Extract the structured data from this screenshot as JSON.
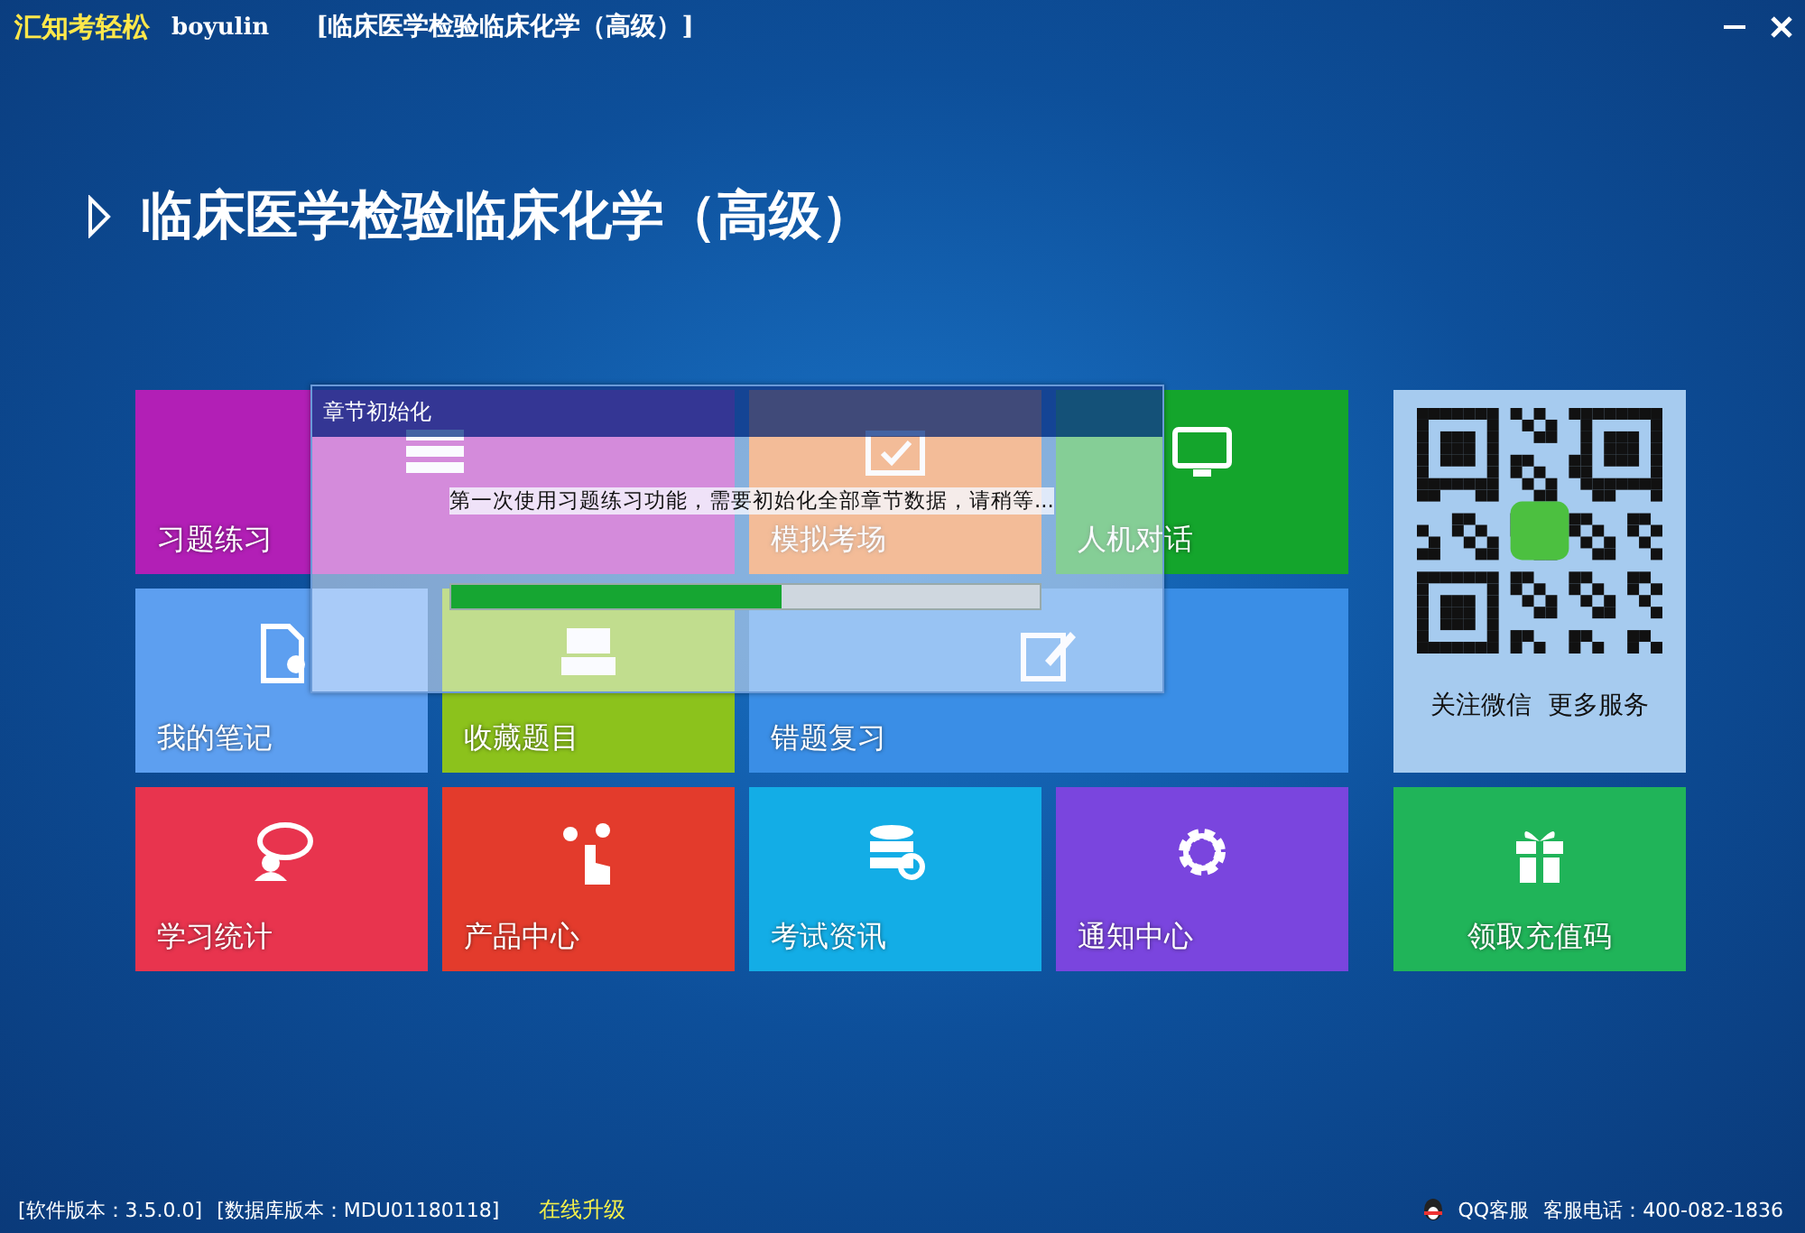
{
  "window": {
    "app_name": "汇知考轻松",
    "user": "boyulin",
    "subject": "[临床医学检验临床化学（高级）]"
  },
  "page_title": "临床医学检验临床化学（高级）",
  "tiles": [
    {
      "label": "习题练习"
    },
    {
      "label": "模拟考场"
    },
    {
      "label": "人机对话"
    },
    {
      "label": "我的笔记"
    },
    {
      "label": "收藏题目"
    },
    {
      "label": "错题复习"
    },
    {
      "label": "学习统计"
    },
    {
      "label": "产品中心"
    },
    {
      "label": "考试资讯"
    },
    {
      "label": "通知中心"
    }
  ],
  "wechat": {
    "caption": "关注微信  更多服务"
  },
  "gift_tile": {
    "label": "领取充值码"
  },
  "dialog": {
    "title": "章节初始化",
    "message": "第一次使用习题练习功能，需要初始化全部章节数据，请稍等...",
    "level": 0.56
  },
  "status_bar": {
    "software_version": "[软件版本：3.5.0.0]",
    "database_version": "[数据库版本：MDU01180118]",
    "upgrade_link": "在线升级",
    "qq_service": "QQ客服",
    "hotline": "客服电话：400-082-1836"
  }
}
